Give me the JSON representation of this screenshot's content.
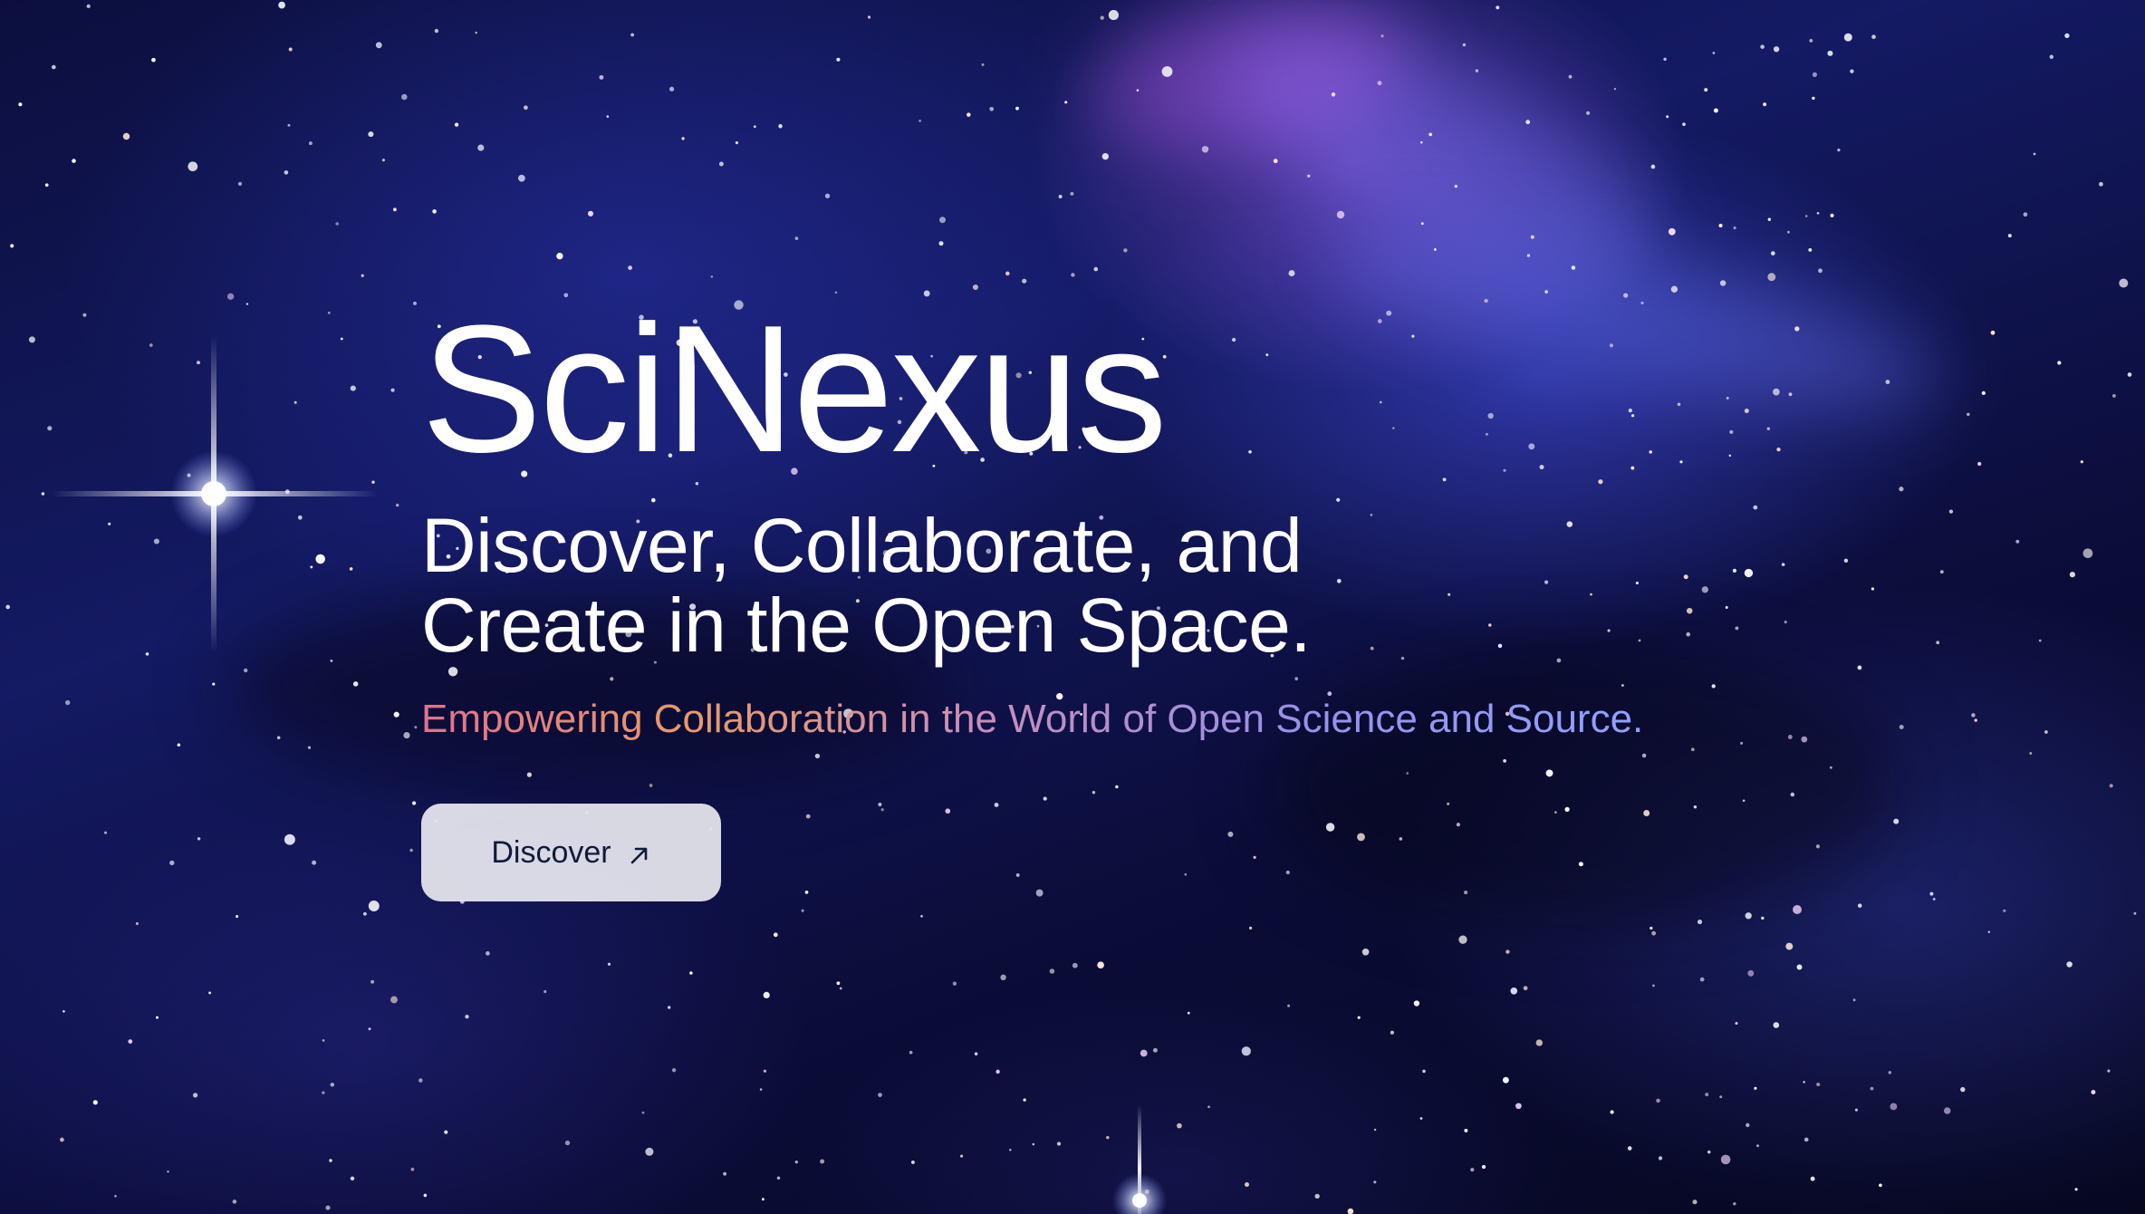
{
  "hero": {
    "title": "SciNexus",
    "headline_line1": "Discover, Collaborate, and",
    "headline_line2": "Create in the Open Space.",
    "tagline": "Empowering Collaboration in the World of Open Science and Source.",
    "cta_label": "Discover",
    "cta_icon": "arrow-up-right-icon"
  },
  "colors": {
    "background_dark": "#06071f",
    "nebula_blue": "#141a63",
    "text_primary": "#ffffff",
    "tagline_gradient": [
      "#e0708f",
      "#e89a6a",
      "#c98fb6",
      "#9a8fe6",
      "#8ea2ff"
    ],
    "button_bg": "#e4e4ec",
    "button_text": "#111a3a"
  }
}
